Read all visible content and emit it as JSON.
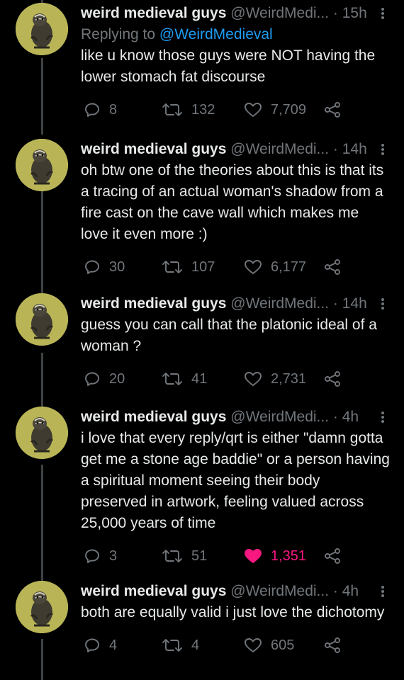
{
  "colors": {
    "background": "#000000",
    "text": "#e7e9ea",
    "muted": "#71767b",
    "link": "#1d9bf0",
    "like_active": "#f91880",
    "avatar_bg": "#b9b557"
  },
  "icons": {
    "reply": "reply-icon",
    "retweet": "retweet-icon",
    "like": "heart-icon",
    "share": "share-icon",
    "more": "more-icon"
  },
  "tweets": [
    {
      "name": "weird medieval guys",
      "handle": "@WeirdMedi...",
      "sep": "·",
      "time": "15h",
      "replying_prefix": "Replying to ",
      "replying_to": "@WeirdMedieval",
      "text": "like u know those guys were NOT having the lower stomach fat discourse",
      "replies": "8",
      "retweets": "132",
      "likes": "7,709",
      "liked": false
    },
    {
      "name": "weird medieval guys",
      "handle": "@WeirdMedi...",
      "sep": "·",
      "time": "14h",
      "text": "oh btw one of the theories about this is that its a tracing of an actual woman's shadow from a fire cast on the cave wall which makes me love it even more :)",
      "replies": "30",
      "retweets": "107",
      "likes": "6,177",
      "liked": false
    },
    {
      "name": "weird medieval guys",
      "handle": "@WeirdMedi...",
      "sep": "·",
      "time": "14h",
      "text": "guess you can call that the platonic ideal of a woman ?",
      "replies": "20",
      "retweets": "41",
      "likes": "2,731",
      "liked": false
    },
    {
      "name": "weird medieval guys",
      "handle": "@WeirdMedi...",
      "sep": "·",
      "time": "4h",
      "text": "i love that every reply/qrt is either \"damn gotta get me a stone age baddie\" or a person having a spiritual moment seeing their body preserved in artwork, feeling valued across 25,000 years of time",
      "replies": "3",
      "retweets": "51",
      "likes": "1,351",
      "liked": true
    },
    {
      "name": "weird medieval guys",
      "handle": "@WeirdMedi...",
      "sep": "·",
      "time": "4h",
      "text": "both are equally valid i just love the dichotomy",
      "replies": "4",
      "retweets": "4",
      "likes": "605",
      "liked": false
    }
  ]
}
